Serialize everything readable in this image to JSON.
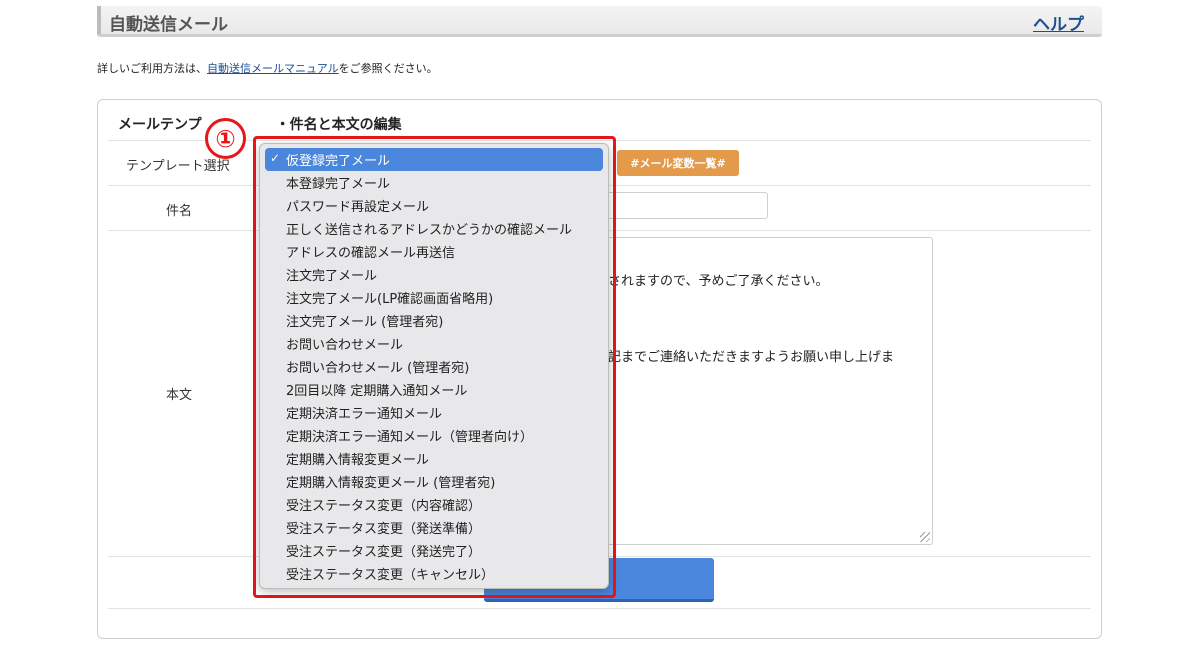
{
  "header": {
    "title": "自動送信メール",
    "help_label": "ヘルプ"
  },
  "intro": {
    "prefix": "詳しいご利用方法は、",
    "link": "自動送信メールマニュアル",
    "suffix": "をご参照ください。"
  },
  "panel": {
    "heading_left": "メールテンプ",
    "heading_right": "・件名と本文の編集",
    "template_label": "テンプレート選択",
    "variables_button": "#メール変数一覧#",
    "subject_label": "件名",
    "body_label": "本文",
    "body_visible_lines": [
      "されますので、予めご了承ください。",
      "記までご連絡いただきますようお願い申し上げま"
    ]
  },
  "annotation": {
    "step": "①"
  },
  "dropdown": {
    "check": "✓",
    "options": [
      "仮登録完了メール",
      "本登録完了メール",
      "パスワード再設定メール",
      "正しく送信されるアドレスかどうかの確認メール",
      "アドレスの確認メール再送信",
      "注文完了メール",
      "注文完了メール(LP確認画面省略用)",
      "注文完了メール (管理者宛)",
      "お問い合わせメール",
      "お問い合わせメール (管理者宛)",
      "2回目以降 定期購入通知メール",
      "定期決済エラー通知メール",
      "定期決済エラー通知メール（管理者向け）",
      "定期購入情報変更メール",
      "定期購入情報変更メール (管理者宛)",
      "受注ステータス変更（内容確認）",
      "受注ステータス変更（発送準備）",
      "受注ステータス変更（発送完了）",
      "受注ステータス変更（キャンセル）"
    ]
  },
  "colors": {
    "accent": "#4a86dc",
    "annotation_red": "#e8161a",
    "variables_orange": "#e39a4a",
    "link_blue": "#1d4f91"
  }
}
